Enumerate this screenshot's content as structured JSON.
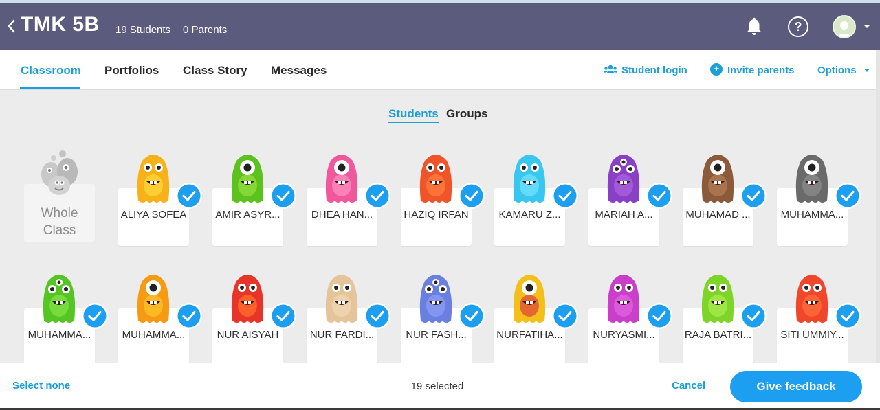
{
  "header": {
    "class_name": "TMK 5B",
    "students_count": "19 Students",
    "parents_count": "0 Parents"
  },
  "nav": {
    "tabs": [
      {
        "label": "Classroom",
        "active": true
      },
      {
        "label": "Portfolios",
        "active": false
      },
      {
        "label": "Class Story",
        "active": false
      },
      {
        "label": "Messages",
        "active": false
      }
    ],
    "student_login": "Student login",
    "invite_parents": "Invite parents",
    "options": "Options"
  },
  "view_toggle": {
    "students": "Students",
    "groups": "Groups",
    "active": "Students"
  },
  "whole_class": {
    "line1": "Whole",
    "line2": "Class"
  },
  "students": [
    {
      "name": "ALIYA SOFEA",
      "selected": true,
      "monster": "orange-yellow-blob"
    },
    {
      "name": "AMIR ASYR...",
      "selected": true,
      "monster": "green-one-eye"
    },
    {
      "name": "DHEA HAN...",
      "selected": true,
      "monster": "pink-one-eye"
    },
    {
      "name": "HAZIQ IRFAN",
      "selected": true,
      "monster": "red-grumpy"
    },
    {
      "name": "KAMARU Z...",
      "selected": true,
      "monster": "cyan-fluffy"
    },
    {
      "name": "MARIAH A...",
      "selected": true,
      "monster": "purple-three-eyes"
    },
    {
      "name": "MUHAMAD ...",
      "selected": true,
      "monster": "brown-furry"
    },
    {
      "name": "MUHAMMA...",
      "selected": true,
      "monster": "gray-one-eye"
    },
    {
      "name": "MUHAMMA...",
      "selected": true,
      "monster": "green-four-eyes"
    },
    {
      "name": "MUHAMMA...",
      "selected": true,
      "monster": "orange-one-eye"
    },
    {
      "name": "NUR AISYAH",
      "selected": true,
      "monster": "red-orange"
    },
    {
      "name": "NUR FARDI...",
      "selected": true,
      "monster": "tan-brown-hair"
    },
    {
      "name": "NUR FASH...",
      "selected": true,
      "monster": "blue-many-eyes"
    },
    {
      "name": "NURFATIHA...",
      "selected": true,
      "monster": "yellow-tentacles"
    },
    {
      "name": "NURYASMI...",
      "selected": true,
      "monster": "magenta-glasses"
    },
    {
      "name": "RAJA BATRI...",
      "selected": true,
      "monster": "lime-spiky"
    },
    {
      "name": "SITI UMMIY...",
      "selected": true,
      "monster": "red-antlers"
    }
  ],
  "footer": {
    "select_none": "Select none",
    "selected_count": "19 selected",
    "cancel": "Cancel",
    "give_feedback": "Give feedback"
  },
  "colors": {
    "header_bg": "#5b5b7e",
    "accent": "#1a9fd9",
    "primary_button": "#1c9ff0",
    "page_bg": "#ececec"
  }
}
